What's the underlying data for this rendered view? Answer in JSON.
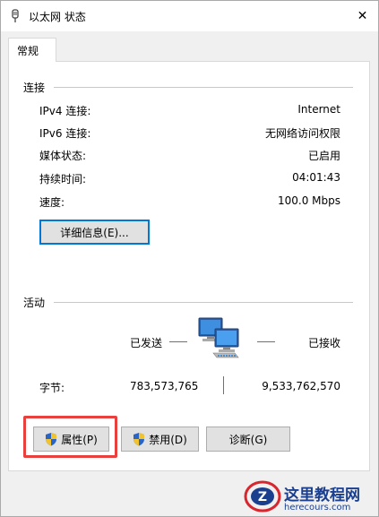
{
  "window": {
    "title": "以太网 状态",
    "close_glyph": "✕"
  },
  "tabs": [
    {
      "label": "常规"
    }
  ],
  "connection": {
    "group_label": "连接",
    "rows": [
      {
        "label": "IPv4 连接:",
        "value": "Internet"
      },
      {
        "label": "IPv6 连接:",
        "value": "无网络访问权限"
      },
      {
        "label": "媒体状态:",
        "value": "已启用"
      },
      {
        "label": "持续时间:",
        "value": "04:01:43"
      },
      {
        "label": "速度:",
        "value": "100.0 Mbps"
      }
    ],
    "details_button": "详细信息(E)..."
  },
  "activity": {
    "group_label": "活动",
    "sent_label": "已发送",
    "received_label": "已接收",
    "bytes_label": "字节:",
    "bytes_sent": "783,573,765",
    "bytes_received": "9,533,762,570"
  },
  "buttons": {
    "properties": "属性(P)",
    "disable": "禁用(D)",
    "diagnose": "诊断(G)"
  },
  "watermark": {
    "text": "这里教程网",
    "url": "herecours.com",
    "logo_letter": "Z"
  },
  "colors": {
    "focus_border": "#0078d7",
    "highlight": "#e8413d",
    "watermark": "#1a3f8f"
  }
}
